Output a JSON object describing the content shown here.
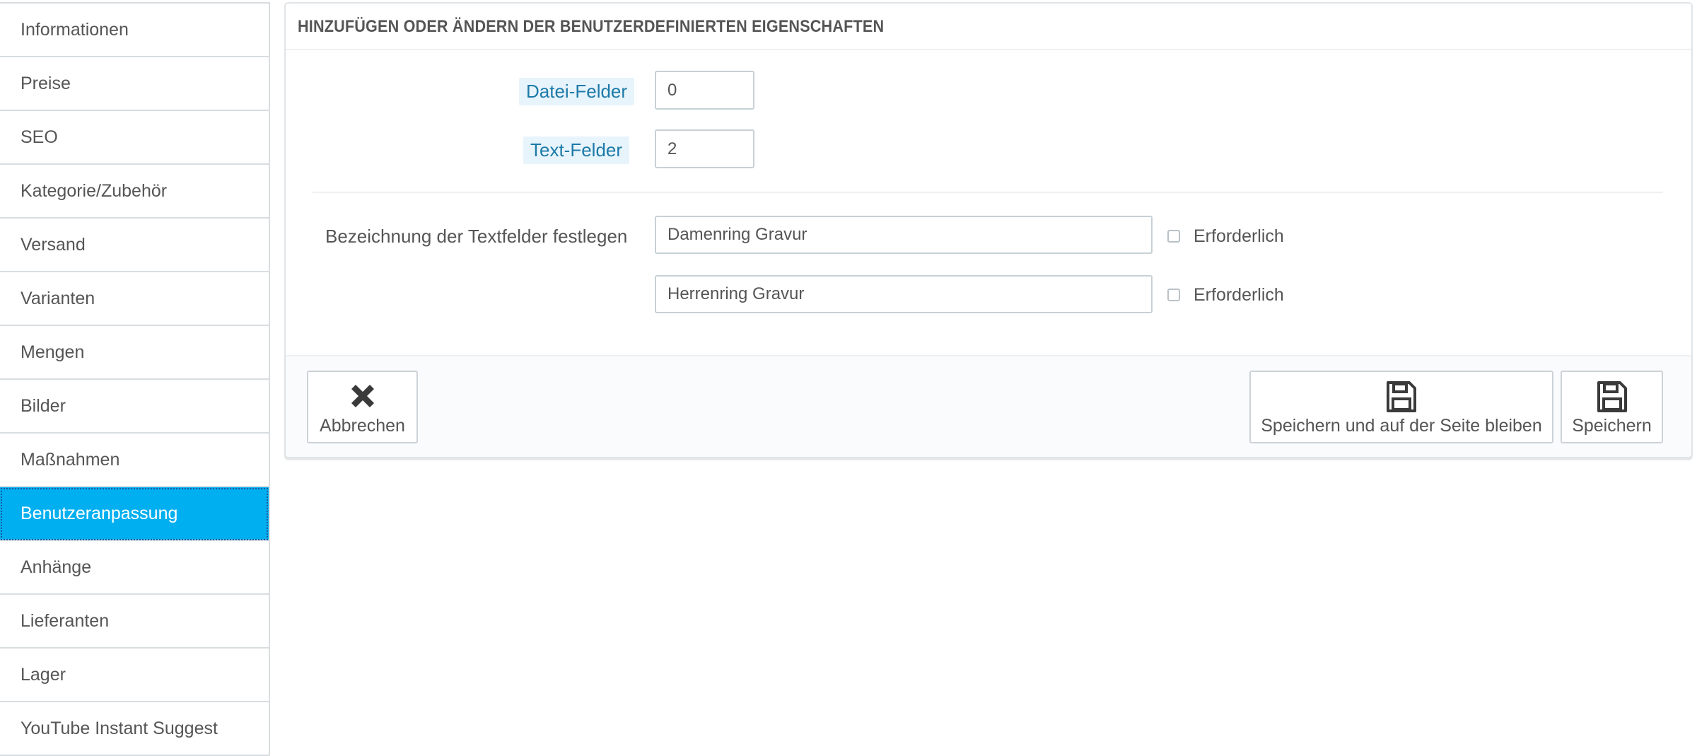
{
  "sidebar": {
    "items": [
      {
        "label": "Informationen"
      },
      {
        "label": "Preise"
      },
      {
        "label": "SEO"
      },
      {
        "label": "Kategorie/Zubehör"
      },
      {
        "label": "Versand"
      },
      {
        "label": "Varianten"
      },
      {
        "label": "Mengen"
      },
      {
        "label": "Bilder"
      },
      {
        "label": "Maßnahmen"
      },
      {
        "label": "Benutzeranpassung",
        "active": true
      },
      {
        "label": "Anhänge"
      },
      {
        "label": "Lieferanten"
      },
      {
        "label": "Lager"
      },
      {
        "label": "YouTube Instant Suggest"
      }
    ]
  },
  "panel": {
    "title": "HINZUFÜGEN ODER ÄNDERN DER BENUTZERDEFINIERTEN EIGENSCHAFTEN",
    "file_fields": {
      "label": "Datei-Felder",
      "value": "0"
    },
    "text_fields": {
      "label": "Text-Felder",
      "value": "2"
    },
    "textfield_labels": {
      "label": "Bezeichnung der Textfelder festlegen",
      "rows": [
        {
          "value": "Damenring Gravur",
          "required_label": "Erforderlich",
          "required": false
        },
        {
          "value": "Herrenring Gravur",
          "required_label": "Erforderlich",
          "required": false
        }
      ]
    }
  },
  "footer": {
    "cancel_label": "Abbrechen",
    "save_stay_label": "Speichern und auf der Seite bleiben",
    "save_label": "Speichern"
  },
  "colors": {
    "accent": "#00aff0",
    "hint_text": "#1c7aa8",
    "hint_bg": "#e8f4fb"
  }
}
